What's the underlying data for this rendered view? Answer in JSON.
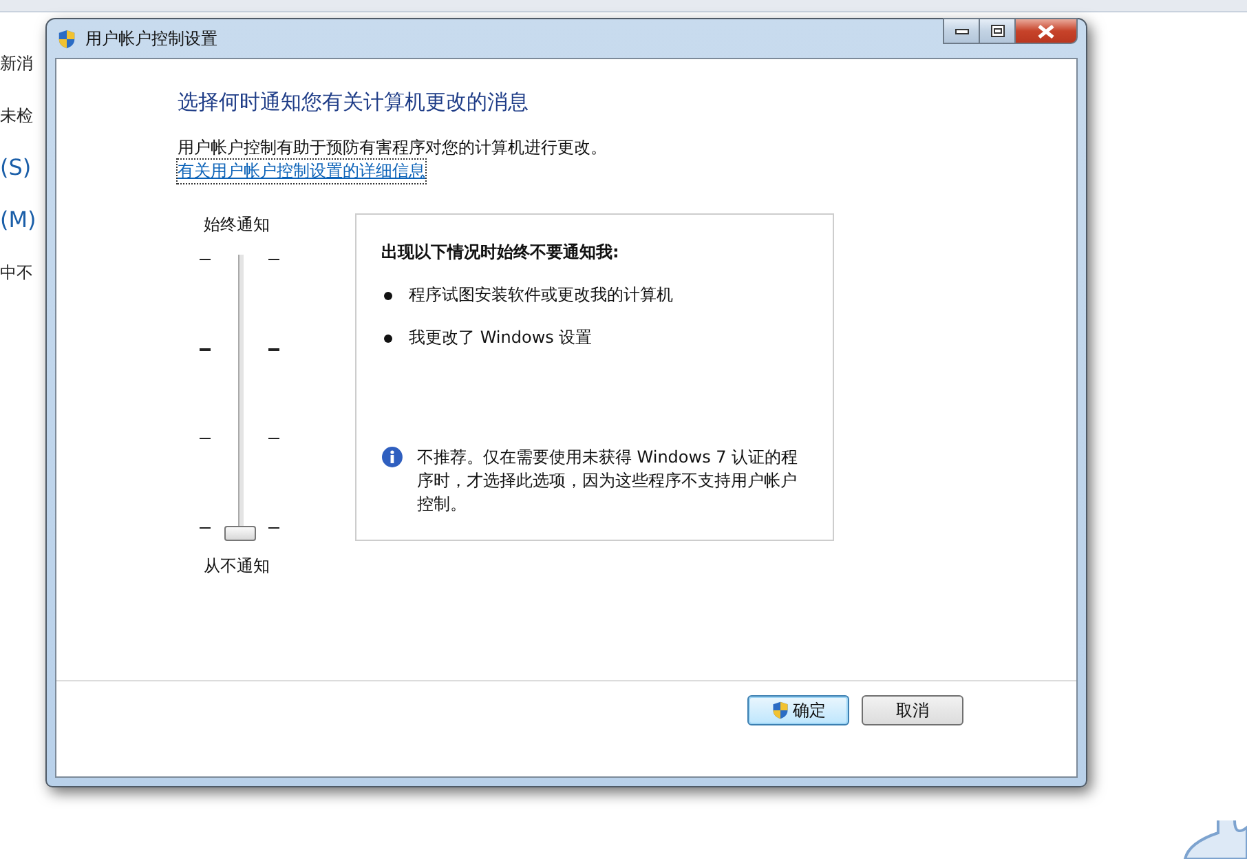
{
  "background_window": {
    "fragments": [
      "新消",
      "未检",
      "(S)",
      "(M)",
      "中不"
    ]
  },
  "dialog": {
    "title": "用户帐户控制设置",
    "heading": "选择何时通知您有关计算机更改的消息",
    "description": "用户帐户控制有助于预防有害程序对您的计算机进行更改。",
    "link": "有关用户帐户控制设置的详细信息",
    "slider": {
      "top_label": "始终通知",
      "bottom_label": "从不通知",
      "level": 0
    },
    "info_box": {
      "title": "出现以下情况时始终不要通知我:",
      "bullets": [
        "程序试图安装软件或更改我的计算机",
        "我更改了 Windows 设置"
      ],
      "note": "不推荐。仅在需要使用未获得 Windows 7 认证的程序时，才选择此选项，因为这些程序不支持用户帐户控制。"
    },
    "buttons": [
      {
        "label": "确定",
        "kind": "shield",
        "selected": true
      },
      {
        "label": "取消",
        "kind": "plain",
        "selected": false
      }
    ]
  }
}
